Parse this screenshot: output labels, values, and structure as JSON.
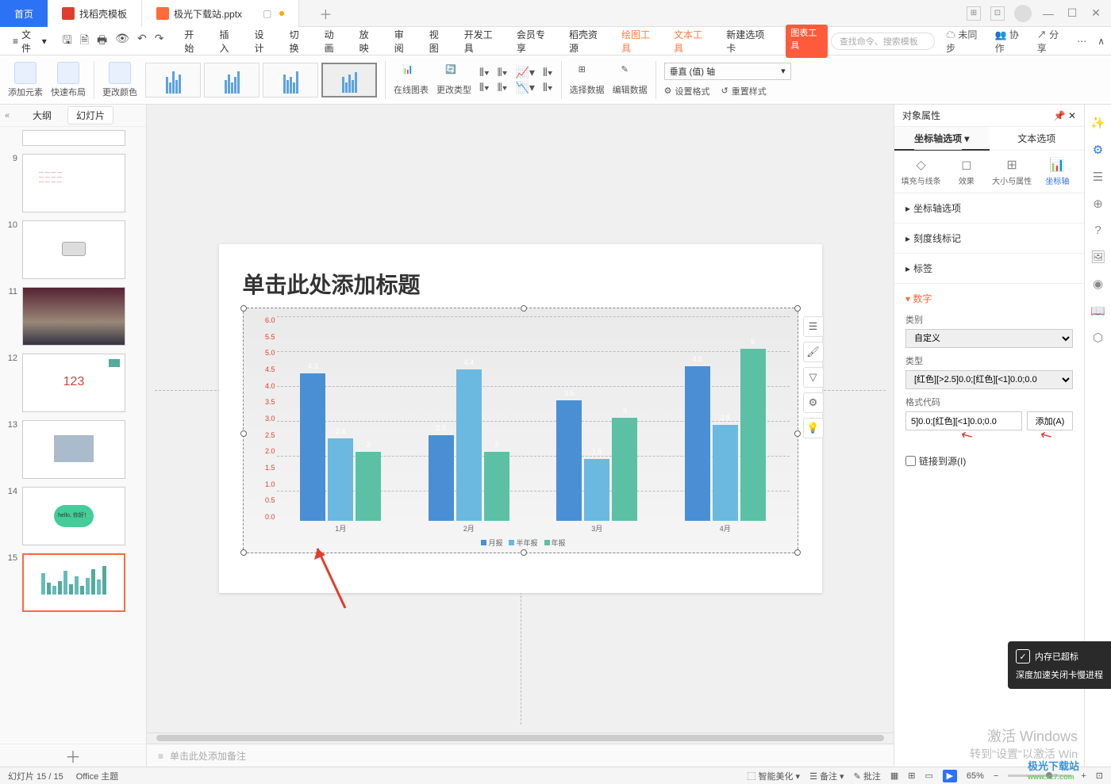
{
  "titlebar": {
    "home": "首页",
    "tab1": "找稻壳模板",
    "tab2": "极光下载站.pptx"
  },
  "menubar": {
    "file": "文件",
    "items": [
      "开始",
      "插入",
      "设计",
      "切换",
      "动画",
      "放映",
      "审阅",
      "视图",
      "开发工具",
      "会员专享",
      "稻壳资源",
      "绘图工具",
      "文本工具",
      "新建选项卡",
      "图表工具"
    ],
    "search_ph": "查找命令、搜索模板",
    "sync": "未同步",
    "coop": "协作",
    "share": "分享"
  },
  "ribbon": {
    "add_elem": "添加元素",
    "quick_layout": "快速布局",
    "change_color": "更改颜色",
    "online_chart": "在线图表",
    "change_type": "更改类型",
    "select_data": "选择数据",
    "edit_data": "编辑数据",
    "axis_dropdown": "垂直 (值) 轴",
    "set_format": "设置格式",
    "reset_style": "重置样式"
  },
  "leftpanel": {
    "outline": "大纲",
    "slides": "幻灯片",
    "nums": [
      "9",
      "10",
      "11",
      "12",
      "13",
      "14",
      "15"
    ],
    "slide12_text": "123",
    "slide14_text": "hello, 你好！"
  },
  "canvas": {
    "title": "单击此处添加标题",
    "notes_ph": "单击此处添加备注",
    "notes_label": "批注"
  },
  "chart_data": {
    "type": "bar",
    "categories": [
      "1月",
      "2月",
      "3月",
      "4月"
    ],
    "series": [
      {
        "name": "月报",
        "color": "#4a8fd4",
        "values": [
          4.3,
          2.5,
          3.5,
          4.5
        ]
      },
      {
        "name": "半年报",
        "color": "#6bb8e0",
        "values": [
          2.4,
          4.4,
          1.8,
          2.8
        ]
      },
      {
        "name": "年报",
        "color": "#5cc0a5",
        "values": [
          2.0,
          2.0,
          3.0,
          5.0
        ]
      }
    ],
    "ylim": [
      0,
      6
    ],
    "yticks": [
      "0.0",
      "0.5",
      "1.0",
      "1.5",
      "2.0",
      "2.5",
      "3.0",
      "3.5",
      "4.0",
      "4.5",
      "5.0",
      "5.5",
      "6.0"
    ]
  },
  "rightpanel": {
    "title": "对象属性",
    "tab_axis": "坐标轴选项",
    "tab_text": "文本选项",
    "sub_fill": "填充与线条",
    "sub_effect": "效果",
    "sub_size": "大小与属性",
    "sub_axis": "坐标轴",
    "sec_axisopt": "坐标轴选项",
    "sec_ticks": "刻度线标记",
    "sec_labels": "标签",
    "sec_number": "数字",
    "lbl_category": "类别",
    "val_category": "自定义",
    "lbl_type": "类型",
    "val_type": "[红色][>2.5]0.0;[红色][<1]0.0;0.0",
    "lbl_format": "格式代码",
    "val_format": "5]0.0;[红色][<1]0.0;0.0",
    "btn_add": "添加(A)",
    "chk_link": "链接到源(I)"
  },
  "statusbar": {
    "slide": "幻灯片 15 / 15",
    "theme": "Office 主题",
    "beautify": "智能美化",
    "notes": "备注",
    "comments": "批注",
    "zoom": "65%"
  },
  "watermark": {
    "l1": "激活 Windows",
    "l2": "转到\"设置\"以激活 Win"
  },
  "toast": {
    "l1": "内存已超标",
    "l2": "深度加速关闭卡慢进程"
  },
  "brand": {
    "l1": "极光下载站",
    "l2": "www.xz7.com"
  }
}
